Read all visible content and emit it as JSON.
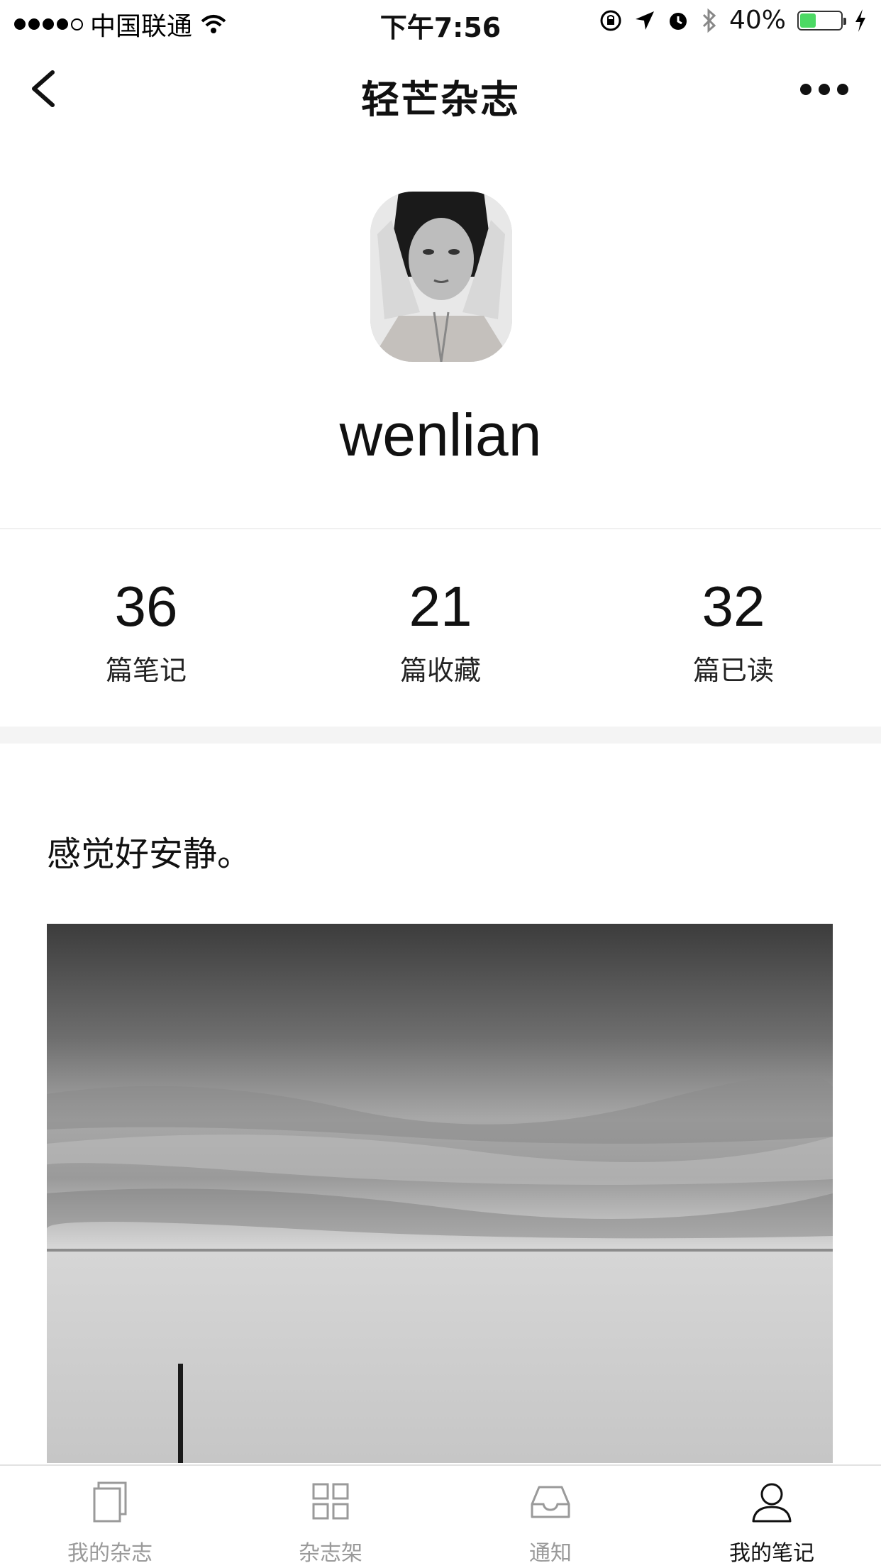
{
  "status_bar": {
    "carrier": "中国联通",
    "time": "下午7:56",
    "battery": "40%",
    "battery_level": 0.4
  },
  "nav": {
    "title": "轻芒杂志",
    "back_icon": "chevron-left-icon",
    "more_icon": "ellipsis-icon"
  },
  "profile": {
    "username": "wenlian"
  },
  "stats": [
    {
      "value": "36",
      "label": "篇笔记"
    },
    {
      "value": "21",
      "label": "篇收藏"
    },
    {
      "value": "32",
      "label": "篇已读"
    }
  ],
  "note": {
    "text": "感觉好安静。"
  },
  "tabs": [
    {
      "label": "我的杂志",
      "icon": "magazine-icon",
      "active": false
    },
    {
      "label": "杂志架",
      "icon": "grid-icon",
      "active": false
    },
    {
      "label": "通知",
      "icon": "inbox-icon",
      "active": false
    },
    {
      "label": "我的笔记",
      "icon": "person-icon",
      "active": true
    }
  ],
  "colors": {
    "battery_fill": "#4cd964",
    "active_tab": "#111111",
    "inactive_tab": "#9a9a9a"
  }
}
